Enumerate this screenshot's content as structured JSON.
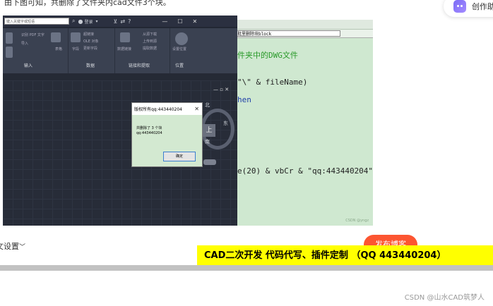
{
  "article": {
    "top_text": "由下图可知，共删除了文件夹内cad文件3个块。",
    "faint_text": "                                                              "
  },
  "float_button": {
    "label": "创作助"
  },
  "editor": {
    "tline_text": "批里删除块block",
    "code_lines": [
      {
        "text": "件夹中的DWG文件",
        "color": "#2a9a2a"
      },
      {
        "text": "\"\\\" & fileName)",
        "color": "#222222"
      },
      {
        "text": "hen",
        "color": "#1f3fa8"
      },
      {
        "text": "e(20) & vbCr & \"qq:443440204\",",
        "color": "#222222"
      }
    ],
    "small_watermark": "CSDN @yngz"
  },
  "cad": {
    "search_placeholder": "键入关键字或短语",
    "login": "登录",
    "window_buttons": {
      "min": "—",
      "max": "☐",
      "close": "✕"
    },
    "ribbon_groups": [
      "输入",
      "数据",
      "链接和提取",
      "位置"
    ],
    "ribbon_items": [
      "识别 PDF 文字",
      "导入",
      "表格",
      "字段",
      "OLE 对象",
      "更新字段",
      "超链接",
      "数据链接",
      "从源下载",
      "上传到源",
      "提取数据",
      "设置位置"
    ],
    "viewcube": {
      "north": "北",
      "east": "东",
      "south": "南",
      "face": "上"
    },
    "vp_controls": "— ▫ ✕"
  },
  "dialog": {
    "title": "版权所有qq:443440204",
    "close": "✕",
    "message_line1": "共删除了 3 个块",
    "message_line2": "qq:443440204",
    "ok_label": "确定"
  },
  "page": {
    "settings_label": "文设置",
    "settings_chevron": "﹀",
    "publish_label": "发布博客",
    "banner_text": "CAD二次开发 代码代写、插件定制 （QQ 443440204）",
    "footer_watermark": "CSDN @山水CAD筑梦人"
  },
  "colors": {
    "editor_bg": "#cfe8d0",
    "cad_bg": "#222733",
    "dialog_bg": "#d3e9d1",
    "banner_bg": "#ffff00",
    "publish_bg": "#fc5531"
  }
}
